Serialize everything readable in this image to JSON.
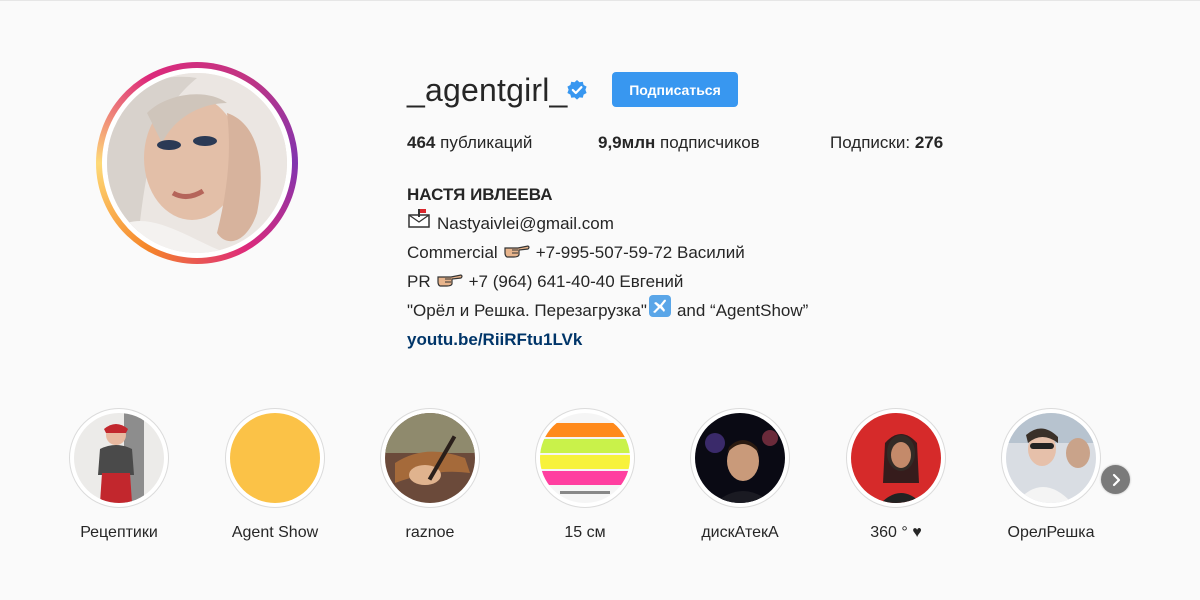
{
  "profile": {
    "username": "_agentgirl_",
    "verified_icon": "verified-badge-icon",
    "follow_label": "Подписаться",
    "stats": {
      "posts_count": "464",
      "posts_label": "публикаций",
      "followers_count": "9,9млн",
      "followers_label": "подписчиков",
      "following_label": "Подписки:",
      "following_count": "276"
    },
    "bio": {
      "name": "НАСТЯ ИВЛЕЕВА",
      "email": "Nastyaivlei@gmail.com",
      "commercial_prefix": "Commercial",
      "commercial_contact": "+7-995-507-59-72 Василий",
      "pr_prefix": "PR",
      "pr_contact": "+7 (964) 641-40-40 Евгений",
      "show_left": "\"Орёл и Решка. Перезагрузка\"",
      "show_right": "and “AgentShow”",
      "link": "youtu.be/RiiRFtu1LVk"
    }
  },
  "highlights": [
    {
      "label": "Рецептики"
    },
    {
      "label": "Agent Show",
      "color": "#fbc247"
    },
    {
      "label": "raznoe"
    },
    {
      "label": "15 см"
    },
    {
      "label": "дискАтекА"
    },
    {
      "label": "360 ° ♥"
    },
    {
      "label": "ОрелРешка"
    }
  ],
  "colors": {
    "accent": "#3897f0",
    "link": "#003569",
    "background": "#fafafa"
  },
  "icons": {
    "mailbox": "mailbox-icon",
    "pointing_hand": "pointing-hand-icon",
    "airplane": "airplane-icon",
    "next": "chevron-right-icon"
  }
}
